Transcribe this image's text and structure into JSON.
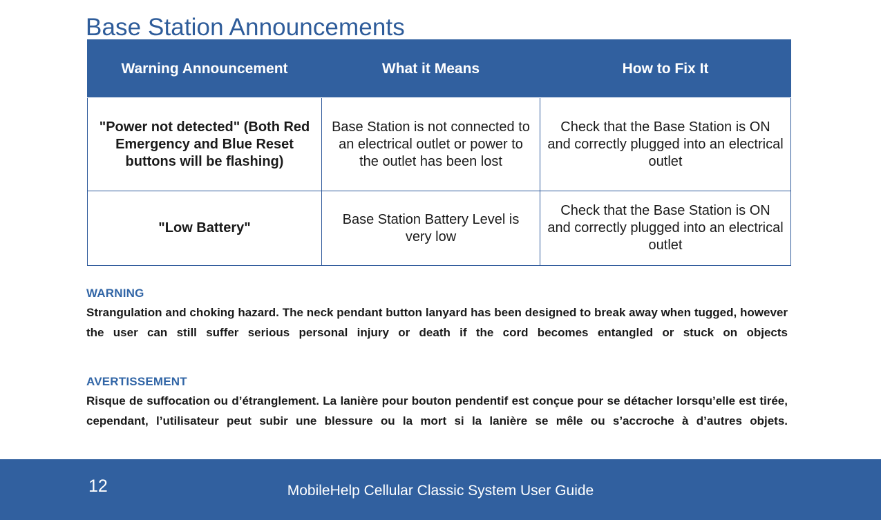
{
  "document": {
    "title": "Base Station Announcements",
    "accent_color": "#2e5c9a",
    "table_header_bg": "#31609f",
    "table_border_color": "#2f5a9b",
    "footer_bg": "#31609f"
  },
  "table": {
    "columns": [
      "Warning Announcement",
      "What it Means",
      "How to Fix It"
    ],
    "rows": [
      {
        "announcement": "\"Power not detected\" (Both Red Emergency and Blue Reset buttons will be flashing)",
        "means": "Base Station is not connected to an electrical outlet or power to the outlet has been lost",
        "fix": "Check that the Base Station is ON and correctly plugged into an electrical outlet"
      },
      {
        "announcement": "\"Low Battery\"",
        "means": "Base Station Battery Level is very low",
        "fix": "Check that the Base Station is ON and correctly plugged into an electrical outlet"
      }
    ]
  },
  "notices": [
    {
      "heading": "WARNING",
      "body": "Strangulation and choking hazard. The neck pendant button lanyard has been designed to break away when tugged, however the user can still suffer serious personal injury or death if the cord becomes entangled or stuck on objects"
    },
    {
      "heading": "AVERTISSEMENT",
      "body": "Risque de suffocation ou d’étranglement. La lanière pour bouton pendentif est conçue pour se détacher lorsqu’elle est tirée, cependant, l’utilisateur peut subir une blessure ou la mort si la lanière se mêle ou s’accroche à d’autres objets."
    }
  ],
  "footer": {
    "page_number": "12",
    "guide_title": "MobileHelp Cellular Classic System User Guide"
  }
}
